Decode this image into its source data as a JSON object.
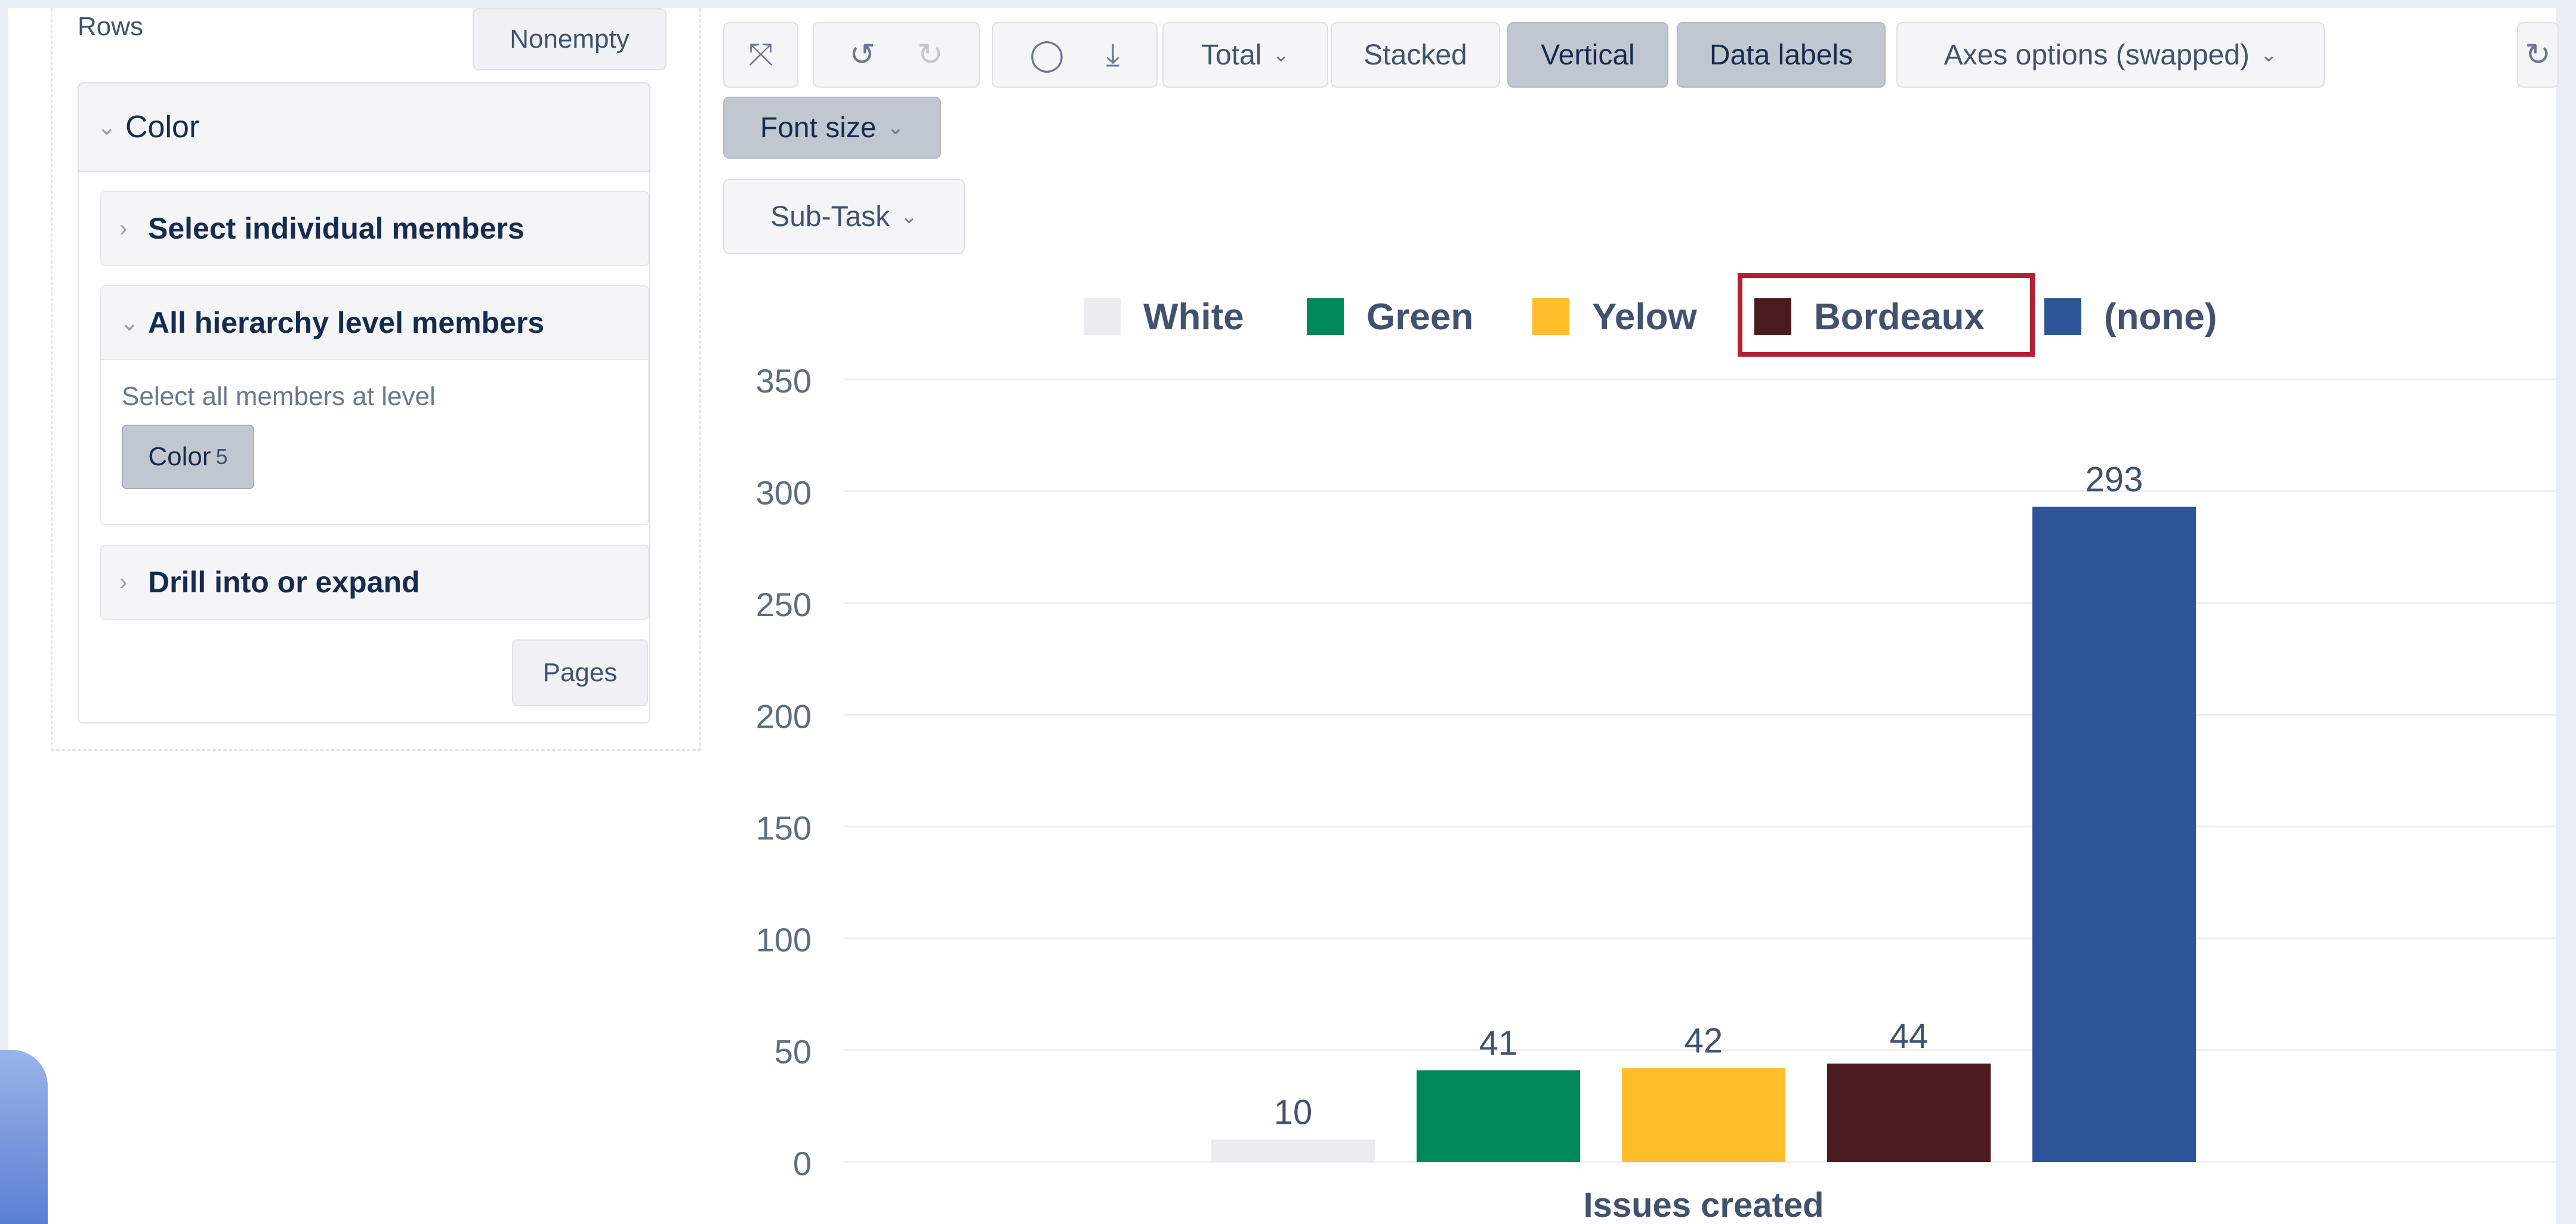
{
  "rows_panel": {
    "title": "Rows",
    "nonempty_label": "Nonempty",
    "dimension": {
      "label": "Color",
      "sections": {
        "select_individual": "Select individual members",
        "all_hierarchy": "All hierarchy level members",
        "select_all_text": "Select all members at level",
        "level_chip": {
          "label": "Color",
          "count": "5"
        },
        "drill": "Drill into or expand"
      }
    },
    "pages_label": "Pages"
  },
  "toolbar": {
    "icons": [
      "fullscreen-icon",
      "undo-icon",
      "redo-icon",
      "comment-icon",
      "download-icon",
      "refresh-icon"
    ],
    "total_label": "Total",
    "stacked_label": "Stacked",
    "vertical_label": "Vertical",
    "data_labels_label": "Data labels",
    "axes_options_label": "Axes options (swapped)",
    "font_size_label": "Font size",
    "subtask_label": "Sub-Task"
  },
  "colors": {
    "White": "#ebecf0",
    "Green": "#00875a",
    "Yelow": "#ffbe2a",
    "Bordeaux": "#4a1c22",
    "(none)": "#2d5499",
    "highlight": "#b22035"
  },
  "chart_data": {
    "type": "bar",
    "title": "",
    "xlabel": "Issues created",
    "ylabel": "",
    "categories": [
      "Issues created"
    ],
    "series": [
      {
        "name": "White",
        "values": [
          10
        ]
      },
      {
        "name": "Green",
        "values": [
          41
        ]
      },
      {
        "name": "Yelow",
        "values": [
          42
        ]
      },
      {
        "name": "Bordeaux",
        "values": [
          44
        ]
      },
      {
        "name": "(none)",
        "values": [
          293
        ]
      }
    ],
    "ylim": [
      0,
      350
    ],
    "yticks": [
      0,
      50,
      100,
      150,
      200,
      250,
      300,
      350
    ],
    "grid": true,
    "legend": "top-center",
    "highlighted_legend_item": "Bordeaux",
    "data_labels": true
  }
}
